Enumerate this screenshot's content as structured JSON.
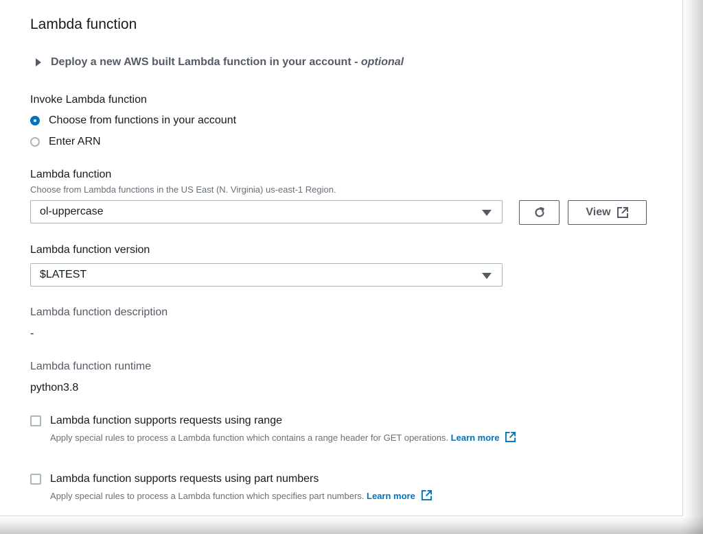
{
  "section": {
    "title": "Lambda function",
    "expander": {
      "text": "Deploy a new AWS built Lambda function in your account - ",
      "optional": "optional"
    }
  },
  "invoke": {
    "label": "Invoke Lambda function",
    "options": [
      {
        "label": "Choose from functions in your account",
        "checked": true
      },
      {
        "label": "Enter ARN",
        "checked": false
      }
    ]
  },
  "function": {
    "label": "Lambda function",
    "description": "Choose from Lambda functions in the US East (N. Virginia) us-east-1 Region.",
    "selected": "ol-uppercase",
    "refresh_icon": "refresh-icon",
    "view_label": "View",
    "view_icon": "external-link-icon"
  },
  "version": {
    "label": "Lambda function version",
    "selected": "$LATEST"
  },
  "fn_description": {
    "label": "Lambda function description",
    "value": "-"
  },
  "runtime": {
    "label": "Lambda function runtime",
    "value": "python3.8"
  },
  "checkboxes": [
    {
      "label": "Lambda function supports requests using range",
      "description": "Apply special rules to process a Lambda function which contains a range header for GET operations.",
      "link": "Learn more"
    },
    {
      "label": "Lambda function supports requests using part numbers",
      "description": "Apply special rules to process a Lambda function which specifies part numbers.",
      "link": "Learn more"
    }
  ],
  "colors": {
    "accent": "#0073bb",
    "text": "#16191f",
    "muted": "#545b64",
    "border": "#aab7b8"
  }
}
